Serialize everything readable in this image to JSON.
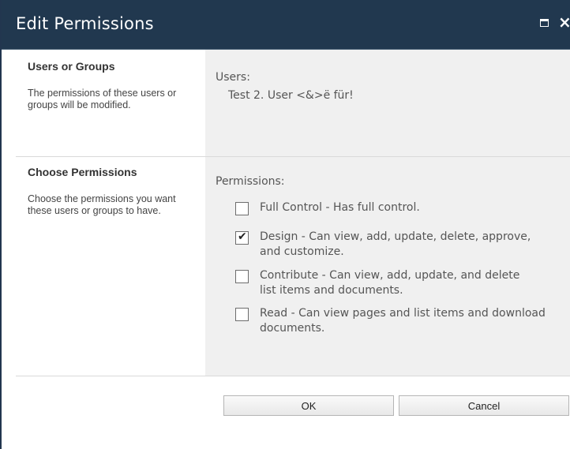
{
  "dialog": {
    "title": "Edit Permissions"
  },
  "users_section": {
    "title": "Users or Groups",
    "description": "The permissions of these users or groups will be modified.",
    "label": "Users:",
    "value": "Test 2. User <&>ë für!"
  },
  "permissions_section": {
    "title": "Choose Permissions",
    "description": "Choose the permissions you want these users or groups to have.",
    "label": "Permissions:",
    "items": [
      {
        "label": "Full Control - Has full control.",
        "checked": false
      },
      {
        "label": "Design - Can view, add, update, delete, approve, and customize.",
        "checked": true
      },
      {
        "label": "Contribute - Can view, add, update, and delete list items and documents.",
        "checked": false
      },
      {
        "label": "Read - Can view pages and list items and download documents.",
        "checked": false
      }
    ]
  },
  "buttons": {
    "ok": "OK",
    "cancel": "Cancel"
  },
  "icons": {
    "maximize": "maximize-icon",
    "close": "close-icon",
    "check": "checkmark-icon"
  },
  "colors": {
    "titlebar": "#21384f",
    "right_panel": "#f0f0f0"
  }
}
